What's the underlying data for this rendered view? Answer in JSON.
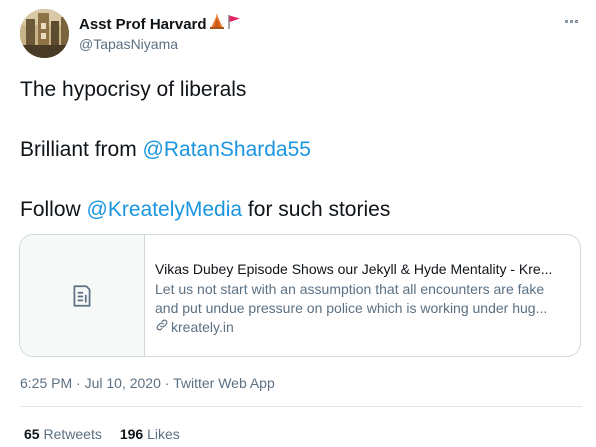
{
  "author": {
    "display_name": "Asst Prof Harvard",
    "handle": "@TapasNiyama"
  },
  "tweet": {
    "line1": "The hypocrisy of liberals",
    "line2_prefix": "Brilliant from ",
    "line2_mention": "@RatanSharda55",
    "line3_prefix": "Follow ",
    "line3_mention": "@KreatelyMedia",
    "line3_suffix": " for such stories"
  },
  "card": {
    "title": "Vikas Dubey Episode Shows our Jekyll & Hyde Mentality - Kre...",
    "description_line1": "Let us not start with an assumption that all encounters are fake",
    "description_line2": "and put undue pressure on police which is working under hug...",
    "domain": "kreately.in",
    "thumbnail_icon": "document-icon"
  },
  "meta": {
    "timestamp": "6:25 PM · Jul 10, 2020",
    "separator": " · ",
    "source": "Twitter Web App"
  },
  "stats": {
    "retweets_count": "65",
    "retweets_label": "Retweets",
    "likes_count": "196",
    "likes_label": "Likes"
  },
  "icons": {
    "more": "more-options-icon",
    "link": "link-icon",
    "emoji_1": "temple-icon",
    "emoji_2": "flag-icon"
  },
  "colors": {
    "accent": "#1b95e0",
    "text_primary": "#0f1419",
    "text_secondary": "#5b7083",
    "border": "#cfd9de"
  }
}
